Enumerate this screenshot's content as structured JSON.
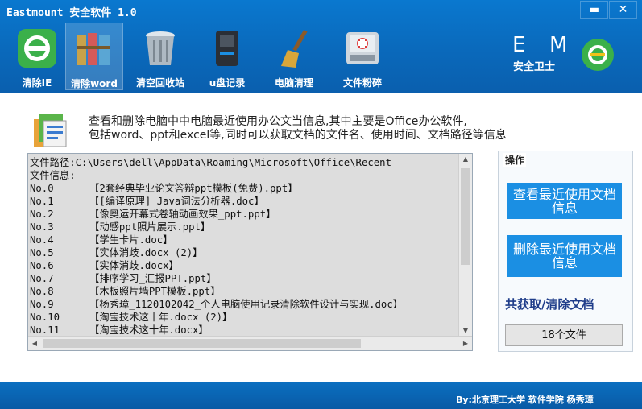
{
  "window": {
    "title": "Eastmount 安全软件 1.0",
    "min_glyph": "▬",
    "close_glyph": "✕"
  },
  "toolbar": {
    "items": [
      {
        "label": "清除IE",
        "icon": "ie-icon"
      },
      {
        "label": "清除word",
        "icon": "books-icon",
        "active": true
      },
      {
        "label": "清空回收站",
        "icon": "recycle-bin-icon"
      },
      {
        "label": "u盘记录",
        "icon": "usb-drive-icon"
      },
      {
        "label": "电脑清理",
        "icon": "broom-icon"
      },
      {
        "label": "文件粉碎",
        "icon": "shredder-icon"
      }
    ]
  },
  "logo": {
    "text": "安全卫士"
  },
  "description": {
    "line1": "查看和删除电脑中中电脑最近使用办公文当信息,其中主要是Office办公软件,",
    "line2": "包括word、ppt和excel等,同时可以获取文档的文件名、使用时间、文档路径等信息"
  },
  "output": {
    "lines": [
      "文件路径:C:\\Users\\dell\\AppData\\Roaming\\Microsoft\\Office\\Recent",
      "文件信息:",
      "No.0      【2套经典毕业论文答辩ppt模板(免费).ppt】",
      "No.1      【[编译原理] Java词法分析器.doc】",
      "No.2      【像奥运开幕式卷轴动画效果_ppt.ppt】",
      "No.3      【动感ppt照片展示.ppt】",
      "No.4      【学生卡片.doc】",
      "No.5      【实体消歧.docx (2)】",
      "No.6      【实体消歧.docx】",
      "No.7      【排序学习_汇报PPT.ppt】",
      "No.8      【木板照片墙PPT模板.ppt】",
      "No.9      【杨秀璋_1120102042_个人电脑使用记录清除软件设计与实现.doc】",
      "No.10     【淘宝技术这十年.docx (2)】",
      "No.11     【淘宝技术这十年.docx】"
    ]
  },
  "operations": {
    "legend": "操作",
    "view_button": "查看最近使用文档信息",
    "delete_button": "删除最近使用文档信息",
    "total_label": "共获取/清除文档",
    "count": "18个文件"
  },
  "footer": {
    "text": "By:北京理工大学 软件学院 杨秀璋"
  },
  "colors": {
    "header": "#0a6fc2",
    "button": "#1b8fe3",
    "total_text": "#1f3d8a"
  }
}
